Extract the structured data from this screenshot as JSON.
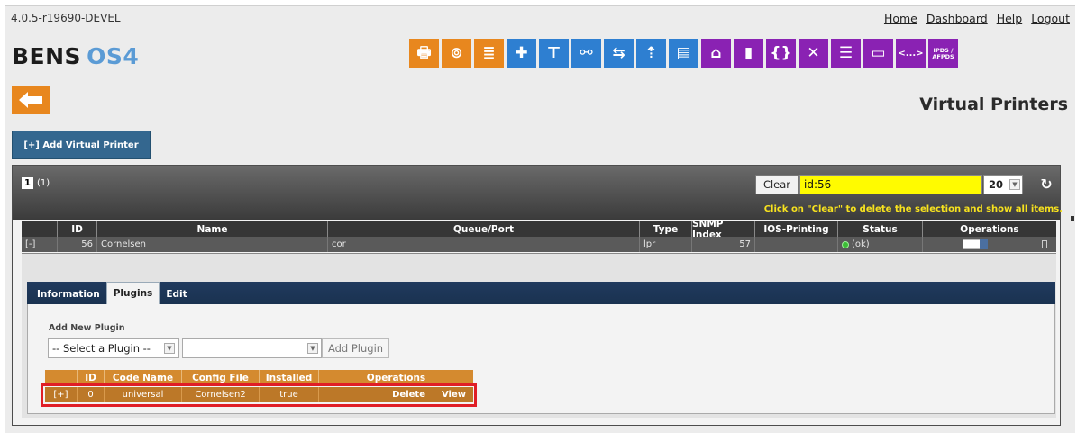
{
  "app": {
    "version": "4.0.5-r19690-DEVEL",
    "brand_part1": "BENS",
    "brand_part2": "OS4",
    "page_title": "Virtual Printers"
  },
  "top_links": [
    "Home",
    "Dashboard",
    "Help",
    "Logout"
  ],
  "toolbar_icons": [
    {
      "name": "printer-icon",
      "color": "orange",
      "glyph": "🖶"
    },
    {
      "name": "printer-cartridge-icon",
      "color": "orange",
      "glyph": "⊚"
    },
    {
      "name": "database-icon",
      "color": "orange",
      "glyph": "≣"
    },
    {
      "name": "plugin-puzzle-icon",
      "color": "blue",
      "glyph": "✚"
    },
    {
      "name": "network-icon",
      "color": "blue",
      "glyph": "⊤"
    },
    {
      "name": "routing-icon",
      "color": "blue",
      "glyph": "⚯"
    },
    {
      "name": "transfer-icon",
      "color": "blue",
      "glyph": "⇆"
    },
    {
      "name": "upload-icon",
      "color": "blue",
      "glyph": "⇡"
    },
    {
      "name": "storage-icon",
      "color": "blue",
      "glyph": "▤"
    },
    {
      "name": "print-job-icon",
      "color": "purple",
      "glyph": "⌂"
    },
    {
      "name": "document-icon",
      "color": "purple",
      "glyph": "▮"
    },
    {
      "name": "script-file-icon",
      "color": "purple",
      "glyph": "{}"
    },
    {
      "name": "tools-icon",
      "color": "purple",
      "glyph": "✕"
    },
    {
      "name": "form-icon",
      "color": "purple",
      "glyph": "☰"
    },
    {
      "name": "window-icon",
      "color": "purple",
      "glyph": "▭"
    },
    {
      "name": "code-icon",
      "color": "purple",
      "glyph": "<...>"
    },
    {
      "name": "ipds-afpds-icon",
      "color": "purple",
      "glyph": "IPDS / AFPDS"
    }
  ],
  "colors": {
    "orange": "#e8871e",
    "blue": "#2e7fd1",
    "purple": "#8a22b3",
    "filter_highlight": "#fffb00",
    "status_ok": "#3cbd36",
    "plugin_header": "#d48a2f"
  },
  "actions": {
    "add_virtual_printer": "[+] Add Virtual Printer"
  },
  "pager": {
    "current_page": "1",
    "page_count": "(1)"
  },
  "filter": {
    "clear_label": "Clear",
    "value": "id:56",
    "page_size": "20",
    "hint": "Click on \"Clear\" to delete the selection and show all items."
  },
  "main_table": {
    "headers": [
      "",
      "ID",
      "Name",
      "Queue/Port",
      "Type",
      "SNMP Index",
      "IOS-Printing",
      "Status",
      "Operations"
    ],
    "rows": [
      {
        "toggle": "[-]",
        "id": "56",
        "name": "Cornelsen",
        "queue_port": "cor",
        "type": "lpr",
        "snmp_index": "57",
        "ios_printing": "",
        "status": "(ok)"
      }
    ]
  },
  "detail_tabs": [
    "Information",
    "Plugins",
    "Edit"
  ],
  "plugins": {
    "add_label": "Add New Plugin",
    "select_placeholder": "-- Select a Plugin --",
    "add_button": "Add Plugin",
    "headers": [
      "",
      "ID",
      "Code Name",
      "Config File",
      "Installed",
      "Operations"
    ],
    "rows": [
      {
        "toggle": "[+]",
        "id": "0",
        "code_name": "universal",
        "config_file": "Cornelsen2",
        "installed": "true",
        "delete": "Delete",
        "view": "View"
      }
    ]
  }
}
